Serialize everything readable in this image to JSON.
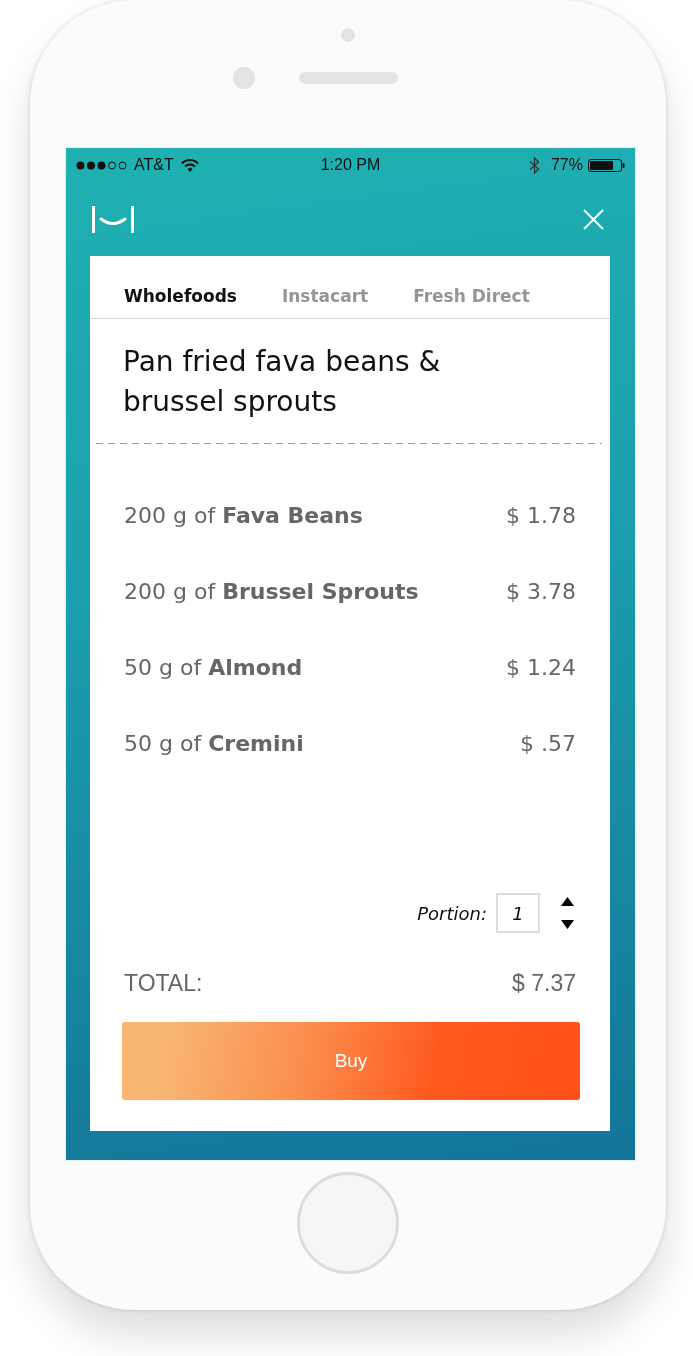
{
  "status_bar": {
    "carrier": "AT&T",
    "time": "1:20 PM",
    "battery": "77%"
  },
  "tabs": [
    {
      "label": "Wholefoods",
      "selected": true
    },
    {
      "label": "Instacart",
      "selected": false
    },
    {
      "label": "Fresh Direct",
      "selected": false
    }
  ],
  "recipe": {
    "title": "Pan fried fava beans & brussel sprouts"
  },
  "ingredients": [
    {
      "text": "200 g of **Fava Beans**",
      "price": "$ 1.78"
    },
    {
      "text": "200 g of **Brussel Sprouts**",
      "price": "$ 3.78"
    },
    {
      "text": "50 g of **Almond**",
      "price": "$ 1.24"
    },
    {
      "text": "50 g of **Cremini**",
      "price": "$ .57"
    }
  ],
  "portion": {
    "label": "Portion:",
    "value": "1"
  },
  "total": {
    "label": "TOTAL:",
    "amount": "$ 7.37"
  },
  "buy_button": {
    "label": "Buy"
  }
}
